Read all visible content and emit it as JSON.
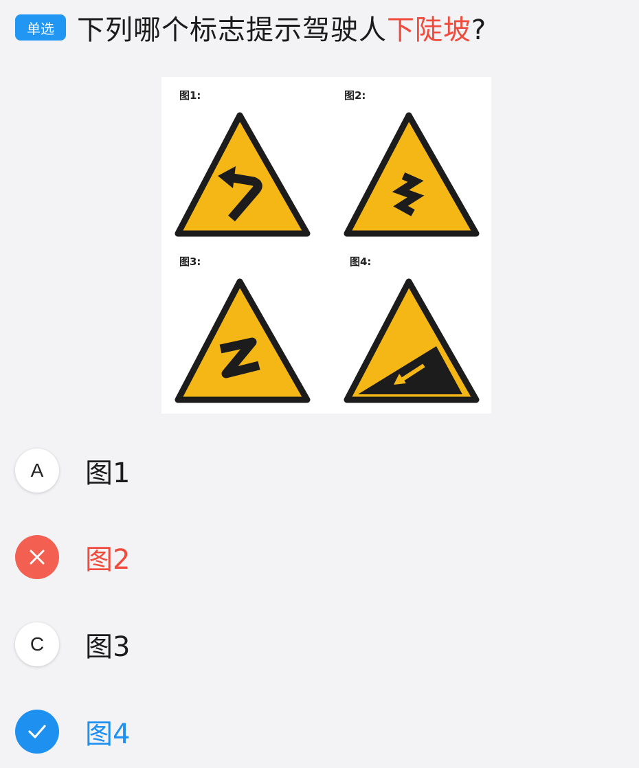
{
  "question": {
    "type_badge": "单选",
    "text_before": "下列哪个标志提示驾驶人",
    "text_highlight": "下陡坡",
    "text_after": "?"
  },
  "signs": [
    {
      "label": "图1:",
      "icon": "curve-left-icon"
    },
    {
      "label": "图2:",
      "icon": "winding-road-icon"
    },
    {
      "label": "图3:",
      "icon": "reverse-curve-icon"
    },
    {
      "label": "图4:",
      "icon": "steep-downhill-icon"
    }
  ],
  "options": [
    {
      "marker": "A",
      "text": "图1",
      "state": "normal"
    },
    {
      "marker": "",
      "text": "图2",
      "state": "wrong",
      "icon": "close-icon"
    },
    {
      "marker": "C",
      "text": "图3",
      "state": "normal"
    },
    {
      "marker": "",
      "text": "图4",
      "state": "correct",
      "icon": "check-icon"
    }
  ],
  "colors": {
    "badge": "#2196f3",
    "highlight": "#f04b3c",
    "wrong": "#f36052",
    "correct": "#1e90ef",
    "sign_yellow": "#f5b716"
  }
}
